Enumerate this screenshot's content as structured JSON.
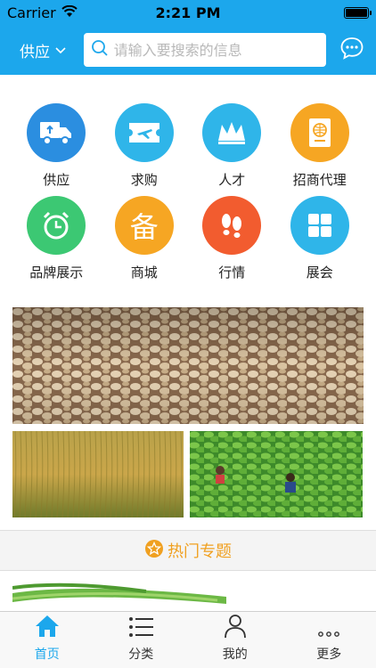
{
  "status_bar": {
    "carrier": "Carrier",
    "time": "2:21 PM"
  },
  "nav": {
    "supply_label": "供应",
    "search_placeholder": "请输入要搜索的信息"
  },
  "categories": [
    {
      "label": "供应",
      "icon": "truck-icon",
      "color": "#2b8ee0"
    },
    {
      "label": "求购",
      "icon": "plane-ticket-icon",
      "color": "#2fb5e9"
    },
    {
      "label": "人才",
      "icon": "crown-icon",
      "color": "#2fb5e9"
    },
    {
      "label": "招商代理",
      "icon": "passport-icon",
      "color": "#f6a623"
    },
    {
      "label": "品牌展示",
      "icon": "alarm-clock-icon",
      "color": "#3cc873"
    },
    {
      "label": "商城",
      "icon": "bei-character-icon",
      "color": "#f6a623",
      "glyph": "备"
    },
    {
      "label": "行情",
      "icon": "footprints-icon",
      "color": "#f25c2f"
    },
    {
      "label": "展会",
      "icon": "grid-icon",
      "color": "#2fb5e9"
    }
  ],
  "section": {
    "title": "热门专题",
    "icon": "star-badge-icon"
  },
  "tabs": [
    {
      "label": "首页",
      "icon": "home-icon",
      "active": true
    },
    {
      "label": "分类",
      "icon": "list-icon",
      "active": false
    },
    {
      "label": "我的",
      "icon": "person-icon",
      "active": false
    },
    {
      "label": "更多",
      "icon": "more-dots-icon",
      "active": false
    }
  ],
  "colors": {
    "brand": "#1ca7ec",
    "accent": "#f0a020"
  }
}
